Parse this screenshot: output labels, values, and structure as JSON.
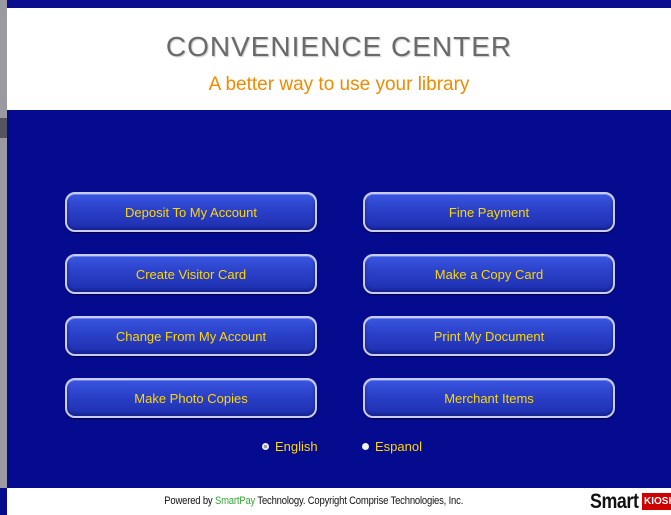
{
  "header": {
    "title": "CONVENIENCE CENTER",
    "subtitle": "A better way to use your library"
  },
  "menu": {
    "deposit": "Deposit To My Account",
    "fine_payment": "Fine Payment",
    "visitor_card": "Create Visitor Card",
    "copy_card": "Make a Copy Card",
    "change": "Change From My Account",
    "print_document": "Print My Document",
    "photo_copies": "Make Photo Copies",
    "merchant_items": "Merchant Items"
  },
  "language": {
    "selected": "English",
    "english": "English",
    "espanol": "Espanol"
  },
  "footer": {
    "powered_by": "Powered by ",
    "brand": "SmartPay",
    "technology": " Technology.  Copyright Comprise Technologies, Inc.",
    "logo_smart": "Smart",
    "logo_kiosk": "KIOSK"
  },
  "colors": {
    "background": "#050b8f",
    "button_text": "#ffd800",
    "subtitle": "#f08a00",
    "title": "#6a6a6a",
    "brand_green": "#3aa63a",
    "logo_red": "#d00000"
  }
}
